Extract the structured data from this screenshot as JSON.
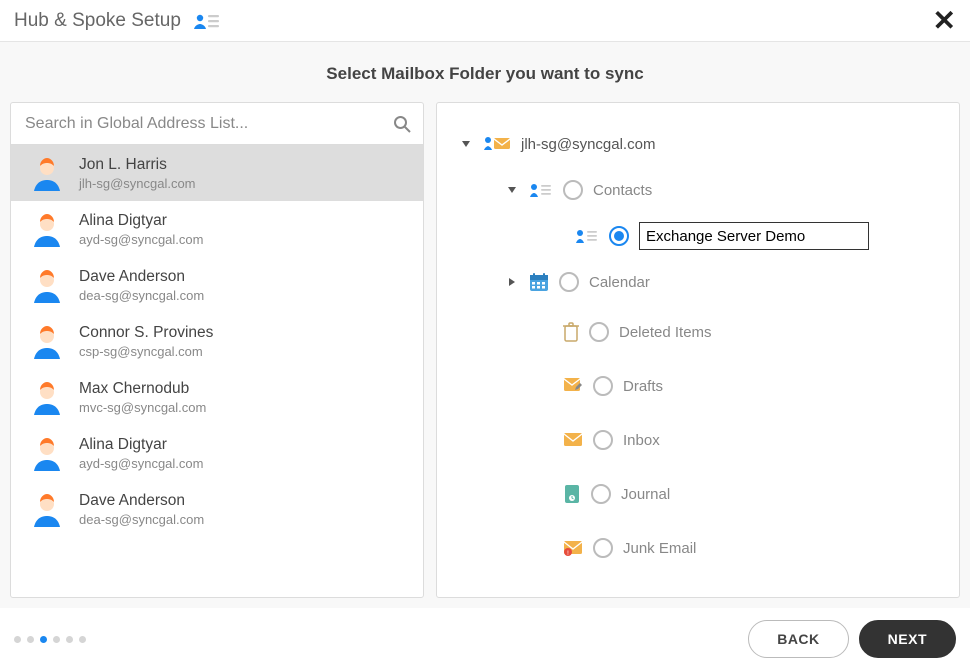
{
  "window": {
    "title": "Hub & Spoke Setup",
    "subtitle": "Select Mailbox Folder you want to sync"
  },
  "search": {
    "placeholder": "Search in Global Address List..."
  },
  "contacts": [
    {
      "name": "Jon L. Harris",
      "email": "jlh-sg@syncgal.com",
      "selected": true
    },
    {
      "name": "Alina Digtyar",
      "email": "ayd-sg@syncgal.com",
      "selected": false
    },
    {
      "name": "Dave Anderson",
      "email": "dea-sg@syncgal.com",
      "selected": false
    },
    {
      "name": "Connor S. Provines",
      "email": "csp-sg@syncgal.com",
      "selected": false
    },
    {
      "name": "Max Chernodub",
      "email": "mvc-sg@syncgal.com",
      "selected": false
    },
    {
      "name": "Alina Digtyar",
      "email": "ayd-sg@syncgal.com",
      "selected": false
    },
    {
      "name": "Dave Anderson",
      "email": "dea-sg@syncgal.com",
      "selected": false
    }
  ],
  "mailbox": {
    "account": "jlh-sg@syncgal.com",
    "selected_folder_name": "Exchange Server Demo",
    "folders": [
      {
        "label": "Contacts",
        "icon": "contacts-icon",
        "expanded": true,
        "selectable": true,
        "selected": false,
        "children": [
          {
            "label": "Exchange Server Demo",
            "icon": "contacts-icon",
            "selectable": true,
            "selected": true,
            "editing": true
          }
        ]
      },
      {
        "label": "Calendar",
        "icon": "calendar-icon",
        "expanded": false,
        "selectable": true,
        "selected": false,
        "has_children": true
      },
      {
        "label": "Deleted Items",
        "icon": "trash-icon",
        "selectable": true,
        "selected": false
      },
      {
        "label": "Drafts",
        "icon": "drafts-icon",
        "selectable": true,
        "selected": false
      },
      {
        "label": "Inbox",
        "icon": "inbox-icon",
        "selectable": true,
        "selected": false
      },
      {
        "label": "Journal",
        "icon": "journal-icon",
        "selectable": true,
        "selected": false
      },
      {
        "label": "Junk Email",
        "icon": "junk-icon",
        "selectable": true,
        "selected": false
      }
    ]
  },
  "pager": {
    "total": 6,
    "active": 3
  },
  "buttons": {
    "back": "BACK",
    "next": "NEXT"
  },
  "colors": {
    "accent": "#1a87f0",
    "avatar_hair": "#ff7a2a",
    "avatar_body": "#1a87f0"
  }
}
